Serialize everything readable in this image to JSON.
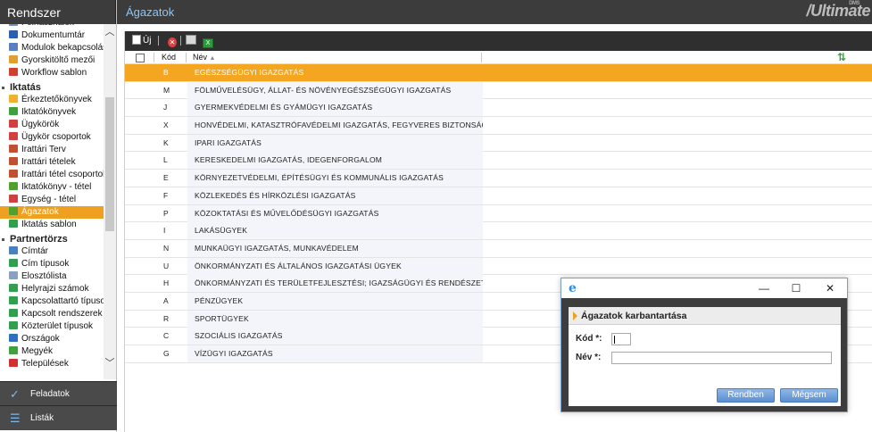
{
  "sidebar": {
    "title": "Rendszer",
    "items_top": [
      {
        "label": "Felhasználók",
        "icon": "users-icon",
        "color": "#6a8fd0"
      },
      {
        "label": "Dokumentumtár",
        "icon": "word-doc-icon",
        "color": "#2b5fb0"
      },
      {
        "label": "Modulok bekapcsolása",
        "icon": "modules-icon",
        "color": "#5a7fc0"
      },
      {
        "label": "Gyorskitöltő mezői",
        "icon": "pencil-icon",
        "color": "#e0a030"
      },
      {
        "label": "Workflow sablon",
        "icon": "workflow-icon",
        "color": "#d04030"
      }
    ],
    "group_iktatas": "Iktatás",
    "items_iktatas": [
      {
        "label": "Érkeztetőkönyvek",
        "icon": "folder-icon",
        "color": "#f0b030"
      },
      {
        "label": "Iktatókönyvek",
        "icon": "book-check-icon",
        "color": "#40a040"
      },
      {
        "label": "Ügykörök",
        "icon": "circles-icon",
        "color": "#d04040"
      },
      {
        "label": "Ügykör csoportok",
        "icon": "circles-group-icon",
        "color": "#d04040"
      },
      {
        "label": "Irattári Terv",
        "icon": "archive-plan-icon",
        "color": "#c05030"
      },
      {
        "label": "Irattári tételek",
        "icon": "archive-items-icon",
        "color": "#c05030"
      },
      {
        "label": "Irattári tétel csoportok",
        "icon": "archive-group-icon",
        "color": "#c05030"
      },
      {
        "label": "Iktatókönyv - tétel",
        "icon": "book-item-icon",
        "color": "#50a030"
      },
      {
        "label": "Egység - tétel",
        "icon": "unit-item-icon",
        "color": "#d04040"
      },
      {
        "label": "Ágazatok",
        "icon": "sector-icon",
        "color": "#50a030",
        "active": true
      },
      {
        "label": "Iktatás sablon",
        "icon": "template-icon",
        "color": "#30a050"
      }
    ],
    "group_partner": "Partnertörzs",
    "items_partner": [
      {
        "label": "Címtár",
        "icon": "directory-icon",
        "color": "#4a80c0"
      },
      {
        "label": "Cím típusok",
        "icon": "address-types-icon",
        "color": "#30a050"
      },
      {
        "label": "Elosztólista",
        "icon": "distribution-list-icon",
        "color": "#8aa0c0"
      },
      {
        "label": "Helyrajzi számok",
        "icon": "parcel-icon",
        "color": "#30a050"
      },
      {
        "label": "Kapcsolattartó típusok",
        "icon": "contact-types-icon",
        "color": "#30a050"
      },
      {
        "label": "Kapcsolt rendszerek",
        "icon": "linked-systems-icon",
        "color": "#30a050"
      },
      {
        "label": "Közterület típusok",
        "icon": "street-types-icon",
        "color": "#30a050"
      },
      {
        "label": "Országok",
        "icon": "globe-icon",
        "color": "#3070c0"
      },
      {
        "label": "Megyék",
        "icon": "county-icon",
        "color": "#40a040"
      },
      {
        "label": "Települések",
        "icon": "settlement-icon",
        "color": "#d03030"
      }
    ],
    "bottom": [
      {
        "label": "Feladatok",
        "icon": "checkmark-icon"
      },
      {
        "label": "Listák",
        "icon": "list-icon"
      }
    ]
  },
  "header": {
    "title": "Ágazatok",
    "brand": "/Ultimate",
    "brand_sup": "DMS"
  },
  "toolbar": {
    "new_label": "Új",
    "delete_icon": "delete-icon",
    "print_icon": "print-icon",
    "excel_icon": "excel-icon"
  },
  "grid": {
    "col_code": "Kód",
    "col_name": "Név",
    "rows": [
      {
        "code": "B",
        "name": "EGÉSZSÉGÜGYI IGAZGATÁS",
        "selected": true
      },
      {
        "code": "M",
        "name": "FÖLMŰVELÉSÜGY, ÁLLAT- ÉS NÖVÉNYEGÉSZSÉGÜGYI IGAZGATÁS"
      },
      {
        "code": "J",
        "name": "GYERMEKVÉDELMI ÉS GYÁMÜGYI IGAZGATÁS"
      },
      {
        "code": "X",
        "name": "HONVÉDELMI, KATASZTRÓFAVÉDELMI IGAZGATÁS, FEGYVERES BIZTONSÁGI..."
      },
      {
        "code": "K",
        "name": "IPARI IGAZGATÁS"
      },
      {
        "code": "L",
        "name": "KERESKEDELMI IGAZGATÁS, IDEGENFORGALOM"
      },
      {
        "code": "E",
        "name": "KÖRNYEZETVÉDELMI, ÉPÍTÉSÜGYI ÉS KOMMUNÁLIS IGAZGATÁS"
      },
      {
        "code": "F",
        "name": "KÖZLEKEDÉS ÉS HÍRKÖZLÉSI IGAZGATÁS"
      },
      {
        "code": "P",
        "name": "KÖZOKTATÁSI ÉS MŰVELŐDÉSÜGYI IGAZGATÁS"
      },
      {
        "code": "I",
        "name": "LAKÁSÜGYEK"
      },
      {
        "code": "N",
        "name": "MUNKAÜGYI IGAZGATÁS, MUNKAVÉDELEM"
      },
      {
        "code": "U",
        "name": "ÖNKORMÁNYZATI ÉS ÁLTALÁNOS IGAZGATÁSI ÜGYEK"
      },
      {
        "code": "H",
        "name": "ÖNKORMÁNYZATI ÉS TERÜLETFEJLESZTÉSI; IGAZSÁGÜGYI ÉS RENDÉSZETI I..."
      },
      {
        "code": "A",
        "name": "PÉNZÜGYEK"
      },
      {
        "code": "R",
        "name": "SPORTÜGYEK"
      },
      {
        "code": "C",
        "name": "SZOCIÁLIS IGAZGATÁS"
      },
      {
        "code": "G",
        "name": "VÍZÜGYI IGAZGATÁS"
      }
    ]
  },
  "dialog": {
    "title": "Ágazatok karbantartása",
    "kod_label": "Kód *:",
    "kod_value": "",
    "nev_label": "Név *:",
    "nev_value": "",
    "ok_label": "Rendben",
    "cancel_label": "Mégsem"
  }
}
